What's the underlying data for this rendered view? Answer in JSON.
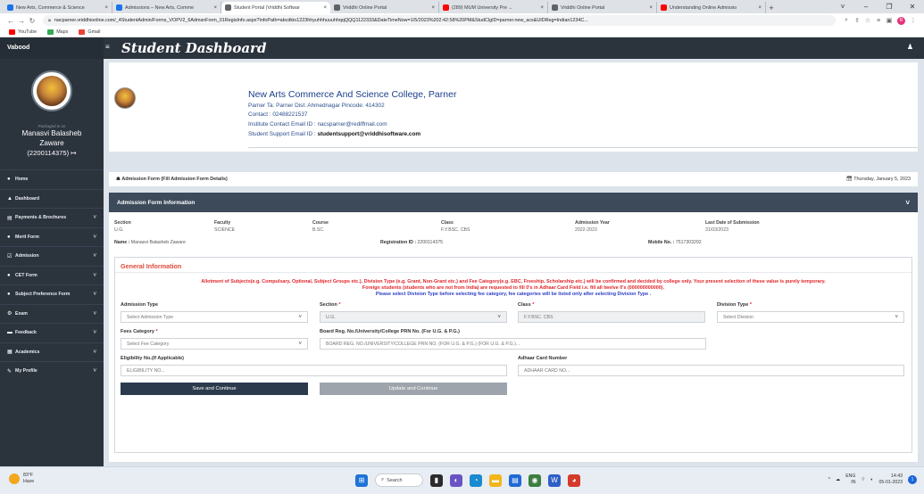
{
  "browser": {
    "tabs": [
      {
        "label": "New Arts, Commerce & Science",
        "color": "#1a73e8"
      },
      {
        "label": "Admissions – New Arts, Comme",
        "color": "#1a73e8"
      },
      {
        "label": "Student Portal (Vriddhi Softwar",
        "color": "#5f6368"
      },
      {
        "label": "Vriddhi Online Portal",
        "color": "#5f6368"
      },
      {
        "label": "(289) MUM University Pre ←",
        "color": "#ff0000"
      },
      {
        "label": "Vriddhi Online Portal",
        "color": "#5f6368"
      },
      {
        "label": "Understanding Online Admissio",
        "color": "#ff0000"
      }
    ],
    "url": "nacparner.vriddhionline.com/_4StudentAdmin/Forms_VOPV2_6AdmsnForm_01RegisInfo.aspx?InfoPath=abcdkio1223hhyuhhhuuuhhqqQQQ1122333&DateTimeNow=1/5/2023%202:42:58%20PM&StudClgID=parner.new_acs&UIDReg=Indian1234C...",
    "bookmarks": [
      {
        "label": "YouTube",
        "color": "#ff0000"
      },
      {
        "label": "Maps",
        "color": "#34a853"
      },
      {
        "label": "Gmail",
        "color": "#ea4335"
      }
    ],
    "profile_initial": "R"
  },
  "app": {
    "brand": "Vabood",
    "title": "Student Dashboard"
  },
  "sidebar": {
    "logged_in_as": "Packaged in as",
    "user_name_1": "Manasvi Balasheb",
    "user_name_2": "Zaware",
    "user_reg": "(2200114375) ↦",
    "items": [
      {
        "label": "Home",
        "icon": "●",
        "caret": ""
      },
      {
        "label": "Dashboard",
        "icon": "▲",
        "caret": ""
      },
      {
        "label": "Payments & Brochures",
        "icon": "▤",
        "caret": "˅"
      },
      {
        "label": "Merit Form",
        "icon": "●",
        "caret": "˅"
      },
      {
        "label": "Admission",
        "icon": "☑",
        "caret": "˅"
      },
      {
        "label": "CET Form",
        "icon": "●",
        "caret": "˅"
      },
      {
        "label": "Subject Preference Form",
        "icon": "●",
        "caret": "˅"
      },
      {
        "label": "Exam",
        "icon": "⚙",
        "caret": "˅"
      },
      {
        "label": "Feedback",
        "icon": "▬",
        "caret": "˅"
      },
      {
        "label": "Academics",
        "icon": "▦",
        "caret": "˅"
      },
      {
        "label": "My Profile",
        "icon": "✎",
        "caret": "˅"
      }
    ]
  },
  "college": {
    "name": "New Arts Commerce And Science College, Parner",
    "address": "Parner Ta: Parner Dist: Ahmednagar Pincode: 414302",
    "contact_label": "Contact : ",
    "contact": "02488221537",
    "email_label": "Institute Contact Email ID : ",
    "email": "nacsparner@rediffmail.com",
    "support_label": "Student Support Email ID : ",
    "support": "studentsupport@vriddhisoftware.com"
  },
  "crumb": {
    "text": "Admission Form (Fill Admission Form Details)",
    "date": "Thursday, January 5, 2023"
  },
  "panel": {
    "header": "Admission Form Information",
    "info": [
      {
        "k": "Section",
        "v": "U.G."
      },
      {
        "k": "Faculty",
        "v": "SCIENCE"
      },
      {
        "k": "Course",
        "v": "B.SC."
      },
      {
        "k": "Class",
        "v": "F.Y.BSC. CBS"
      },
      {
        "k": "Admission Year",
        "v": "2022-2023"
      },
      {
        "k": "Last Date of Submission",
        "v": "31/03/2023"
      }
    ],
    "name_label": "Name : ",
    "name_value": "Manasvi Balasheb Zaware",
    "reg_label": "Registration ID : ",
    "reg_value": "2200114375",
    "mobile_label": "Mobile No. : ",
    "mobile_value": "7517303292"
  },
  "general": {
    "title": "General Information",
    "notice_1": "Allotment of Subjects(e.g. Compulsary, Optional, Subject Groups etc.), Division Type (e.g. Grant, Non-Grant etc.) and Fee Category(e.g. EBC, Freeship, Scholarship etc.) will be confirmed and decided by college only. Your present selection of these value is purely temporary.",
    "notice_2": "Foreign students (students who are not from India) are requested to fill 0's in Adhaar Card Field i.e. fill all twelve 0's (000000000000).",
    "notice_3": "Please select Division Type before selecting fee category, fee categories will be listed only after selecting Division Type .",
    "fields": {
      "admission_type_label": "Admission Type",
      "admission_type_value": "Select Admission Type",
      "section_label": "Section",
      "section_value": "U.G.",
      "class_label": "Class",
      "class_value": "F.Y.BSC. CBS",
      "division_label": "Division Type",
      "division_value": "Select Division",
      "fees_label": "Fees Category",
      "fees_value": "Select Fee Category",
      "board_label": "Board Reg. No./University/College PRN No. (For U.G. & P.G.)",
      "board_placeholder": "BOARD REG. NO./UNIVERSITY/COLLEGE PRN NO. (FOR U.G. & P.G.) (FOR U.G. & P.G.)...",
      "elig_label": "Eligibility No.(If Applicable)",
      "elig_placeholder": "ELIGIBILITY NO...",
      "adhaar_label": "Adhaar Card Number",
      "adhaar_placeholder": "ADHAAR CARD NO..."
    },
    "required_mark": "*",
    "save_label": "Save and Continue",
    "update_label": "Update and Continue"
  },
  "taskbar": {
    "temp": "83°F",
    "weather": "Haze",
    "search": "Search",
    "lang_1": "ENG",
    "lang_2": "IN",
    "time": "14:43",
    "date": "05-01-2023",
    "notif": "1"
  }
}
